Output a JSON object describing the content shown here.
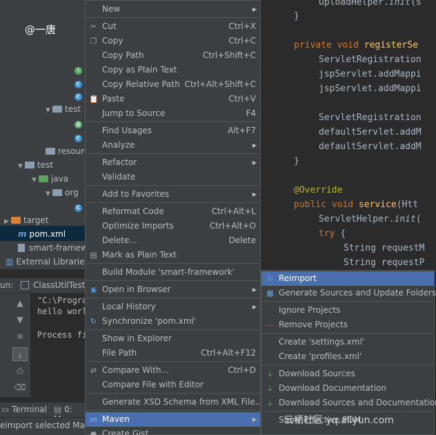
{
  "watermark_user": "@一唐",
  "watermark_site": "云栖社区 yq.aliyun.com",
  "project_tree": {
    "test_folder_1": "test",
    "resources": "resource",
    "test_folder_2": "test",
    "java": "java",
    "org": "org",
    "target": "target",
    "pom": "pom.xml",
    "module_file": "smart-framewo",
    "external_libraries": "External Libraries"
  },
  "run_panel": {
    "header_prefix": "un:",
    "tab_label": "ClassUtilTest.g",
    "lines": [
      "\"C:\\Progra",
      "hello worl",
      "",
      "Process fi"
    ],
    "bottom_tab_terminal": "Terminal",
    "bottom_tab_messages": "0: Mes",
    "status_text": "eimport selected Maven"
  },
  "editor": {
    "lines": [
      {
        "indent": "    ",
        "parts": [
          {
            "t": "UploadHelper.",
            "c": ""
          },
          {
            "t": "init",
            "c": "it"
          },
          {
            "t": "(s",
            "c": ""
          }
        ]
      },
      {
        "indent": "",
        "parts": [
          {
            "t": "}",
            "c": ""
          }
        ]
      },
      {
        "indent": "",
        "parts": []
      },
      {
        "indent": "",
        "parts": [
          {
            "t": "private void ",
            "c": "kw"
          },
          {
            "t": "registerSe",
            "c": "fn"
          }
        ]
      },
      {
        "indent": "    ",
        "parts": [
          {
            "t": "ServletRegistration",
            "c": ""
          }
        ]
      },
      {
        "indent": "    ",
        "parts": [
          {
            "t": "jspServlet.addMappi",
            "c": ""
          }
        ]
      },
      {
        "indent": "    ",
        "parts": [
          {
            "t": "jspServlet.addMappi",
            "c": ""
          }
        ]
      },
      {
        "indent": "",
        "parts": []
      },
      {
        "indent": "    ",
        "parts": [
          {
            "t": "ServletRegistration",
            "c": ""
          }
        ]
      },
      {
        "indent": "    ",
        "parts": [
          {
            "t": "defaultServlet.addM",
            "c": ""
          }
        ]
      },
      {
        "indent": "    ",
        "parts": [
          {
            "t": "defaultServlet.addM",
            "c": ""
          }
        ]
      },
      {
        "indent": "",
        "parts": [
          {
            "t": "}",
            "c": ""
          }
        ]
      },
      {
        "indent": "",
        "parts": []
      },
      {
        "indent": "",
        "parts": [
          {
            "t": "@Override",
            "c": "ann"
          }
        ]
      },
      {
        "indent": "",
        "parts": [
          {
            "t": "public void ",
            "c": "kw"
          },
          {
            "t": "service",
            "c": "fn"
          },
          {
            "t": "(Htt",
            "c": ""
          }
        ]
      },
      {
        "indent": "    ",
        "parts": [
          {
            "t": "ServletHelper.",
            "c": ""
          },
          {
            "t": "init",
            "c": "it"
          },
          {
            "t": "(",
            "c": ""
          }
        ]
      },
      {
        "indent": "    ",
        "parts": [
          {
            "t": "try ",
            "c": "kw"
          },
          {
            "t": "{",
            "c": ""
          }
        ]
      },
      {
        "indent": "        ",
        "parts": [
          {
            "t": "String requestM",
            "c": ""
          }
        ]
      },
      {
        "indent": "        ",
        "parts": [
          {
            "t": "String requestP",
            "c": ""
          }
        ]
      }
    ]
  },
  "context_menu": {
    "items": [
      {
        "label": "New",
        "shortcut": "",
        "submenu": true,
        "icon": ""
      },
      {
        "sep": true
      },
      {
        "label": "Cut",
        "shortcut": "Ctrl+X",
        "icon": "✂"
      },
      {
        "label": "Copy",
        "shortcut": "Ctrl+C",
        "icon": "❐"
      },
      {
        "label": "Copy Path",
        "shortcut": "Ctrl+Shift+C",
        "icon": ""
      },
      {
        "label": "Copy as Plain Text",
        "shortcut": "",
        "icon": ""
      },
      {
        "label": "Copy Relative Path",
        "shortcut": "Ctrl+Alt+Shift+C",
        "icon": ""
      },
      {
        "label": "Paste",
        "shortcut": "Ctrl+V",
        "icon": "📋"
      },
      {
        "label": "Jump to Source",
        "shortcut": "F4",
        "icon": ""
      },
      {
        "sep": true
      },
      {
        "label": "Find Usages",
        "shortcut": "Alt+F7",
        "icon": ""
      },
      {
        "label": "Analyze",
        "shortcut": "",
        "submenu": true,
        "icon": ""
      },
      {
        "sep": true
      },
      {
        "label": "Refactor",
        "shortcut": "",
        "submenu": true,
        "icon": ""
      },
      {
        "label": "Validate",
        "shortcut": "",
        "icon": ""
      },
      {
        "sep": true
      },
      {
        "label": "Add to Favorites",
        "shortcut": "",
        "submenu": true,
        "icon": ""
      },
      {
        "sep": true
      },
      {
        "label": "Reformat Code",
        "shortcut": "Ctrl+Alt+L",
        "icon": ""
      },
      {
        "label": "Optimize Imports",
        "shortcut": "Ctrl+Alt+O",
        "icon": ""
      },
      {
        "label": "Delete...",
        "shortcut": "Delete",
        "icon": ""
      },
      {
        "label": "Mark as Plain Text",
        "shortcut": "",
        "icon": "▤"
      },
      {
        "sep": true
      },
      {
        "label": "Build Module 'smart-framework'",
        "shortcut": "",
        "icon": ""
      },
      {
        "sep": true
      },
      {
        "label": "Open in Browser",
        "shortcut": "",
        "submenu": true,
        "icon": "◉"
      },
      {
        "sep": true
      },
      {
        "label": "Local History",
        "shortcut": "",
        "submenu": true,
        "icon": ""
      },
      {
        "label": "Synchronize 'pom.xml'",
        "shortcut": "",
        "icon": "↻"
      },
      {
        "sep": true
      },
      {
        "label": "Show in Explorer",
        "shortcut": "",
        "icon": ""
      },
      {
        "label": "File Path",
        "shortcut": "Ctrl+Alt+F12",
        "icon": ""
      },
      {
        "sep": true
      },
      {
        "label": "Compare With...",
        "shortcut": "Ctrl+D",
        "icon": "⇄"
      },
      {
        "label": "Compare File with Editor",
        "shortcut": "",
        "icon": ""
      },
      {
        "sep": true
      },
      {
        "label": "Generate XSD Schema from XML File...",
        "shortcut": "",
        "icon": ""
      },
      {
        "sep": true
      },
      {
        "label": "Maven",
        "shortcut": "",
        "submenu": true,
        "icon": "m",
        "selected": true
      },
      {
        "label": "Create Gist...",
        "shortcut": "",
        "icon": "●"
      }
    ]
  },
  "maven_submenu": {
    "items": [
      {
        "label": "Reimport",
        "icon": "↻",
        "selected": true
      },
      {
        "label": "Generate Sources and Update Folders",
        "icon": "▦"
      },
      {
        "sep": true
      },
      {
        "label": "Ignore Projects",
        "icon": ""
      },
      {
        "label": "Remove Projects",
        "icon": "—"
      },
      {
        "sep": true
      },
      {
        "label": "Create 'settings.xml'",
        "icon": ""
      },
      {
        "label": "Create 'profiles.xml'",
        "icon": ""
      },
      {
        "sep": true
      },
      {
        "label": "Download Sources",
        "icon": "⤓"
      },
      {
        "label": "Download Documentation",
        "icon": "⤓"
      },
      {
        "label": "Download Sources and Documentation",
        "icon": "⤓"
      },
      {
        "sep": true
      },
      {
        "label": "Show Effective POM",
        "icon": ""
      }
    ]
  },
  "colors": {
    "menu_bg": "#3c3f41",
    "selection": "#4b6eaf",
    "editor_bg": "#2b2b2b",
    "keyword": "#cc7832",
    "function": "#ffc66d",
    "annotation": "#bbb529",
    "remove_icon": "#d04a3a",
    "download_icon": "#5fb24a",
    "reimport_icon": "#5fa0e0"
  }
}
